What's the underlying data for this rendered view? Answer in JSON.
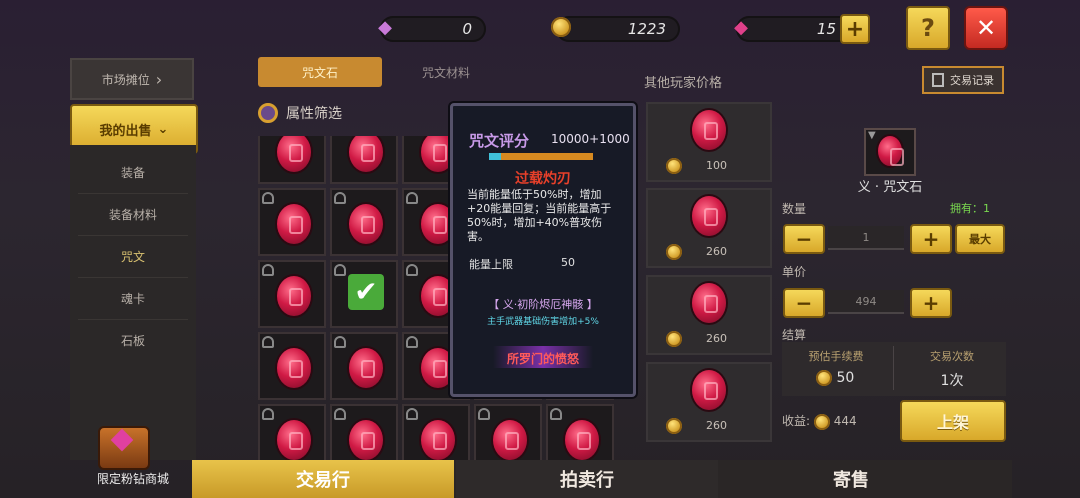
{
  "currency": {
    "gems": "0",
    "gold": "1223",
    "diamond": "15"
  },
  "top_buttons": {
    "help": "?",
    "close": "✕",
    "add": "+"
  },
  "sidebar": {
    "market_stall": "市场摊位",
    "my_sales": "我的出售",
    "items": [
      "装备",
      "装备材料",
      "咒文",
      "魂卡",
      "石板"
    ],
    "shop_label": "限定粉钻商城"
  },
  "tabs": {
    "rune_stone": "咒文石",
    "rune_material": "咒文材料"
  },
  "filter": {
    "label": "属性筛选"
  },
  "popup": {
    "score_label": "咒文评分",
    "score_value": "10000+1000",
    "skill_name": "过载灼刃",
    "skill_desc": "当前能量低于50%时，增加+20能量回复；当前能量高于50%时，增加+40%普攻伤害。",
    "stat_label": "能量上限",
    "stat_value": "50",
    "set_name": "【 义·初阶烬厄神骸 】",
    "set_effect": "主手武器基础伤害增加+5%",
    "source": "所罗门的愤怒"
  },
  "other_prices": {
    "title": "其他玩家价格",
    "prices": [
      "100",
      "260",
      "260",
      "260"
    ]
  },
  "trade_log": "交易记录",
  "item": {
    "name": "义 · 咒文石",
    "quantity_label": "数量",
    "owned": "拥有：1",
    "quantity": "1",
    "max": "最大",
    "unit_price_label": "单价",
    "unit_price": "494",
    "minus": "−",
    "plus": "+"
  },
  "settlement": {
    "label": "结算",
    "fee_label": "预估手续费",
    "fee_value": "50",
    "count_label": "交易次数",
    "count_value": "1次",
    "income_label": "收益:",
    "income_value": "444",
    "list_button": "上架"
  },
  "bottom_tabs": [
    "交易行",
    "拍卖行",
    "寄售"
  ],
  "colors": {
    "accent_yellow": "#e8c34a",
    "gem_red": "#d01a45",
    "popup_purple": "#b07ad8"
  }
}
